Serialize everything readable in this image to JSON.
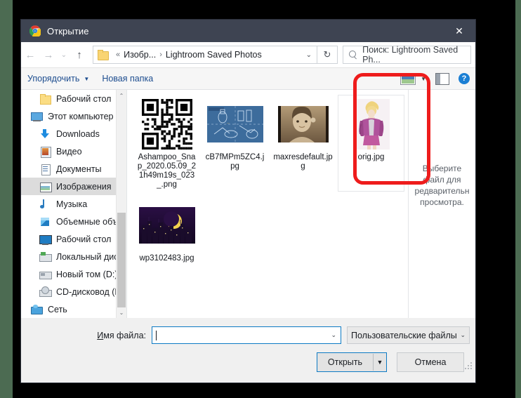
{
  "window": {
    "title": "Открытие",
    "app_icon": "chrome-logo-icon",
    "close_label": "✕"
  },
  "nav": {
    "back_icon": "←",
    "forward_icon": "→",
    "recent_icon": "⌄",
    "up_icon": "↑",
    "refresh_icon": "↻",
    "breadcrumb": {
      "folder_icon": "folder-icon",
      "overflow": "«",
      "parent": "Изобр...",
      "separator": "›",
      "current": "Lightroom Saved Photos",
      "dropdown_icon": "⌄"
    },
    "search": {
      "icon": "search-icon",
      "value": "Поиск: Lightroom Saved Ph..."
    }
  },
  "toolbar": {
    "organize_label": "Упорядочить",
    "organize_caret": "▼",
    "new_folder_label": "Новая папка",
    "view_icon": "view-layout-icon",
    "view_caret": "▼",
    "preview_pane_icon": "preview-pane-icon",
    "help_label": "?"
  },
  "sidebar": {
    "items": [
      {
        "label": "Рабочий стол",
        "icon": "folder-icon",
        "iconclass": "ic-folder",
        "indent": true,
        "selected": false
      },
      {
        "label": "Этот компьютер",
        "icon": "this-pc-icon",
        "iconclass": "ic-pc",
        "indent": false,
        "selected": false
      },
      {
        "label": "Downloads",
        "icon": "downloads-icon",
        "iconclass": "ic-down",
        "indent": true,
        "selected": false
      },
      {
        "label": "Видео",
        "icon": "videos-icon",
        "iconclass": "ic-video",
        "indent": true,
        "selected": false
      },
      {
        "label": "Документы",
        "icon": "documents-icon",
        "iconclass": "ic-doc",
        "indent": true,
        "selected": false
      },
      {
        "label": "Изображения",
        "icon": "pictures-icon",
        "iconclass": "ic-pics",
        "indent": true,
        "selected": true
      },
      {
        "label": "Музыка",
        "icon": "music-icon",
        "iconclass": "ic-music",
        "indent": true,
        "selected": false
      },
      {
        "label": "Объемные объ",
        "icon": "3d-objects-icon",
        "iconclass": "ic-3d",
        "indent": true,
        "selected": false
      },
      {
        "label": "Рабочий стол",
        "icon": "desktop-icon",
        "iconclass": "ic-desk",
        "indent": true,
        "selected": false
      },
      {
        "label": "Локальный дис",
        "icon": "local-disk-icon",
        "iconclass": "ic-drive",
        "indent": true,
        "selected": false
      },
      {
        "label": "Новый том (D:)",
        "icon": "volume-icon",
        "iconclass": "ic-drive2",
        "indent": true,
        "selected": false
      },
      {
        "label": "CD-дисковод (F",
        "icon": "cd-drive-icon",
        "iconclass": "ic-cd",
        "indent": true,
        "selected": false
      },
      {
        "label": "Сеть",
        "icon": "network-icon",
        "iconclass": "ic-net",
        "indent": false,
        "selected": false
      }
    ],
    "scroll_up_icon": "⌃",
    "scroll_down_icon": "⌄"
  },
  "files": [
    {
      "name": "Ashampoo_Snap_2020.05.09_21h49m19s_023_.png",
      "thumb": "qr",
      "selected": false
    },
    {
      "name": "cB7fMPm5ZC4.jpg",
      "thumb": "blueprint",
      "selected": false
    },
    {
      "name": "maxresdefault.jpg",
      "thumb": "sepia",
      "selected": false
    },
    {
      "name": "orig.jpg",
      "thumb": "portrait",
      "selected": true
    },
    {
      "name": "wp3102483.jpg",
      "thumb": "city",
      "selected": false
    }
  ],
  "preview": {
    "placeholder_lines": [
      "Выберите",
      "файл для",
      "редварительн",
      "просмотра."
    ]
  },
  "footer": {
    "filename_label_prefix": "И",
    "filename_label_rest": "мя файла:",
    "filename_value": "",
    "filename_dropdown_icon": "⌄",
    "filter_value": "Пользовательские файлы (*.jf",
    "filter_dropdown_icon": "⌄",
    "open_label": "Открыть",
    "open_caret": "▼",
    "cancel_label": "Отмена"
  },
  "annotation": {
    "shape": "rounded-rectangle-highlight",
    "color": "#ee1c1c",
    "targets": "orig.jpg"
  }
}
